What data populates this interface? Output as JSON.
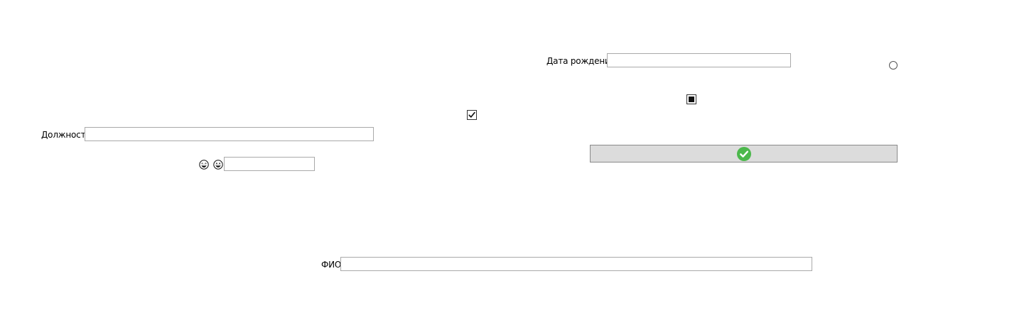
{
  "form": {
    "birth_date": {
      "label": "Дата рождения",
      "value": "",
      "placeholder": ""
    },
    "position": {
      "label": "Должность",
      "value": "",
      "placeholder": ""
    },
    "full_name": {
      "label": "ФИО",
      "value": "",
      "placeholder": ""
    },
    "emoji_field": {
      "value": "",
      "placeholder": ""
    },
    "checkbox_checked": true,
    "checkbox_indeterminate": true,
    "radio_selected": false,
    "submit": {
      "icon": "check-circle-icon",
      "icon_color": "#4cb84c",
      "background": "#dcdcdc"
    },
    "icons": [
      "laughing-emoji-icon",
      "grinning-emoji-icon"
    ]
  }
}
